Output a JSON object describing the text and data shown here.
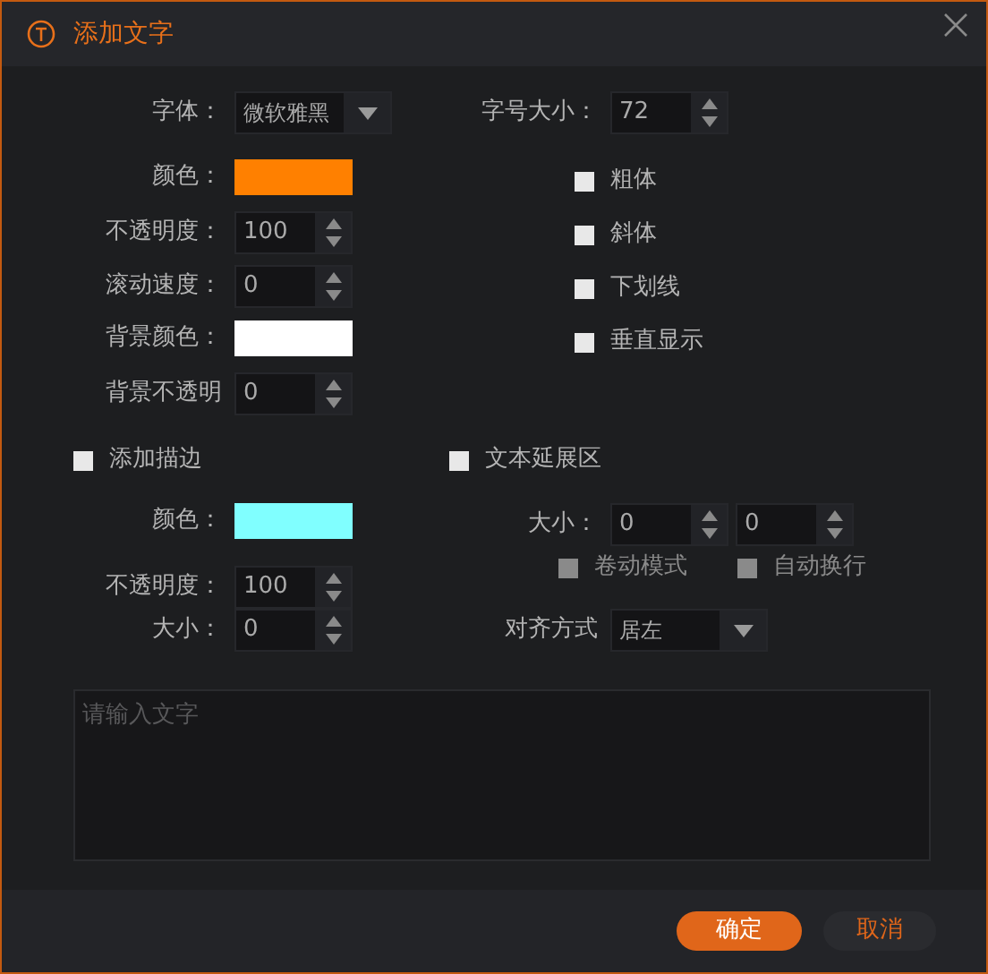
{
  "window": {
    "title": "添加文字"
  },
  "font": {
    "label": "字体：",
    "value": "微软雅黑"
  },
  "font_size": {
    "label": "字号大小：",
    "value": "72"
  },
  "text_settings": [
    {
      "kind": "color",
      "label": "颜色：",
      "color": "#ff8000"
    },
    {
      "kind": "spinner",
      "label": "不透明度：",
      "value": "100"
    },
    {
      "kind": "spinner",
      "label": "滚动速度：",
      "value": "0"
    },
    {
      "kind": "color",
      "label": "背景颜色：",
      "color": "#ffffff"
    },
    {
      "kind": "spinner",
      "label": "背景不透明",
      "value": "0"
    }
  ],
  "styles": [
    {
      "label": "粗体",
      "checked": false
    },
    {
      "label": "斜体",
      "checked": false
    },
    {
      "label": "下划线",
      "checked": false
    },
    {
      "label": "垂直显示",
      "checked": false
    }
  ],
  "outline": {
    "label": "添加描边",
    "checked": false,
    "settings": [
      {
        "kind": "color",
        "label": "颜色：",
        "color": "#80ffff"
      },
      {
        "kind": "spinner",
        "label": "不透明度：",
        "value": "100"
      },
      {
        "kind": "spinner",
        "label": "大小：",
        "value": "0"
      }
    ]
  },
  "extend": {
    "label": "文本延展区",
    "checked": false,
    "size": {
      "label": "大小：",
      "values": [
        "0",
        "0"
      ]
    },
    "options": [
      {
        "label": "卷动模式",
        "checked": false,
        "disabled": true
      },
      {
        "label": "自动换行",
        "checked": false,
        "disabled": true
      }
    ],
    "align": {
      "label": "对齐方式",
      "value": "居左"
    }
  },
  "text_input": {
    "placeholder": "请输入文字"
  },
  "buttons": [
    {
      "label": "确定",
      "kind": "primary"
    },
    {
      "label": "取消",
      "kind": "secondary"
    }
  ]
}
